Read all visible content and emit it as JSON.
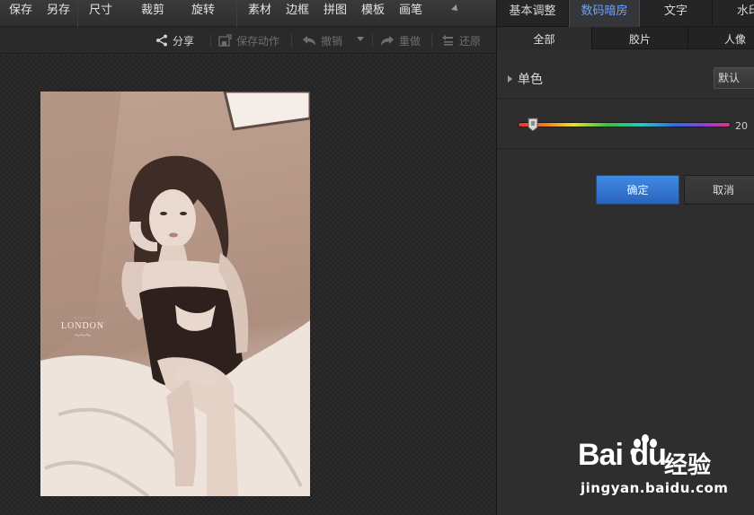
{
  "menubar": {
    "items": [
      "保存",
      "另存",
      "尺寸",
      "裁剪",
      "旋转",
      "素材",
      "边框",
      "拼图",
      "模板",
      "画笔"
    ],
    "more_icon": "expand-triangle-icon"
  },
  "toolbar": {
    "share": "分享",
    "save_action": "保存动作",
    "undo": "撤销",
    "redo": "重做",
    "restore": "还原"
  },
  "photo": {
    "watermark": "LONDON"
  },
  "panel": {
    "tabs": [
      "基本调整",
      "数码暗房",
      "文字",
      "水印"
    ],
    "active_tab": "数码暗房",
    "subtabs": [
      "全部",
      "胶片",
      "人像"
    ],
    "active_subtab": "全部",
    "effect_label": "单色",
    "default_button": "默认",
    "slider": {
      "value": "20",
      "fraction": 0.07
    },
    "ok_button": "确定",
    "cancel_button": "取消"
  },
  "watermark": {
    "logo_text": "Bai du",
    "jingyan": "经验",
    "url": "jingyan.baidu.com"
  },
  "colors": {
    "accent_blue": "#6ea3ff",
    "ok_button": "#3f8ae3"
  }
}
